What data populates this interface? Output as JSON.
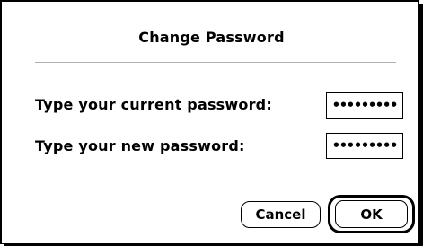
{
  "dialog": {
    "title": "Change Password",
    "fields": [
      {
        "label": "Type your current password:",
        "value": "•••••••••"
      },
      {
        "label": "Type your new password:",
        "value": "•••••••••"
      }
    ],
    "buttons": {
      "cancel_label": "Cancel",
      "ok_label": "OK",
      "default": "ok"
    }
  }
}
